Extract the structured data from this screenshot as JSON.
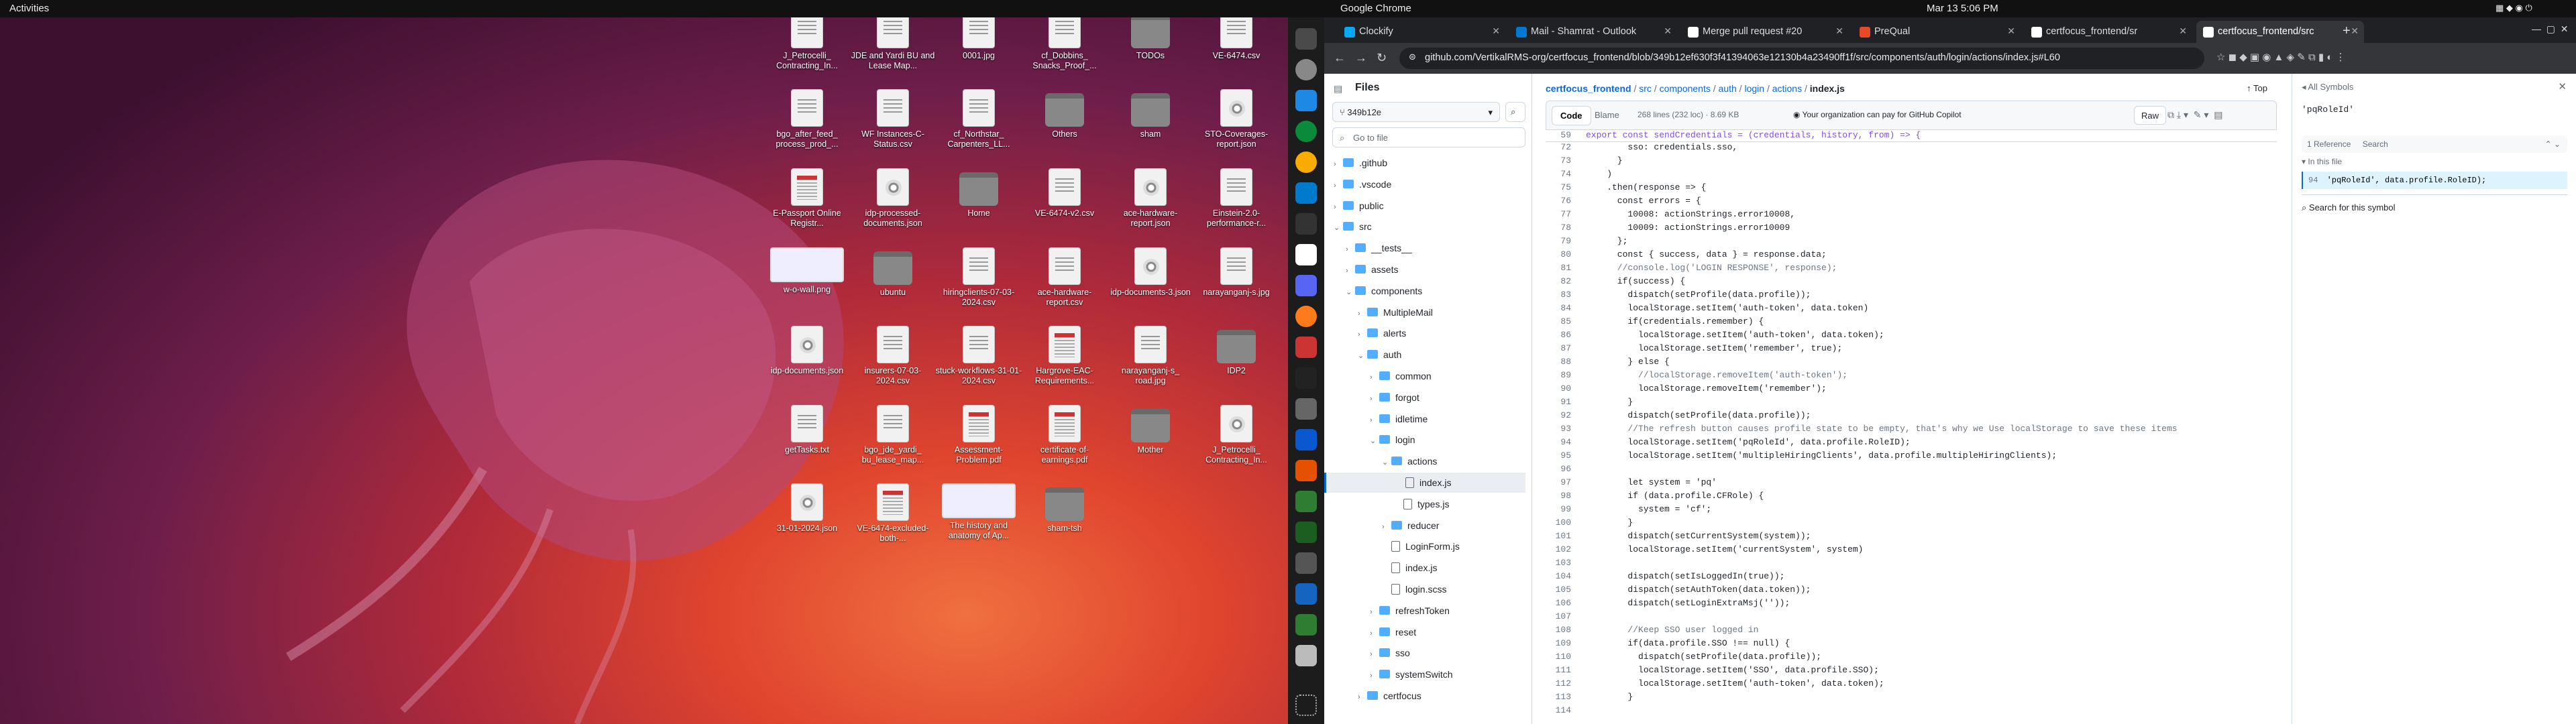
{
  "topbar": {
    "activities": "Activities",
    "app": "Google Chrome",
    "clock": "Mar 13  5:06 PM"
  },
  "desktop": {
    "icons": [
      {
        "label": "J_Petrocelli_ Contracting_In...",
        "type": "doc"
      },
      {
        "label": "JDE and Yardi BU and Lease Map...",
        "type": "doc"
      },
      {
        "label": "0001.jpg",
        "type": "doc"
      },
      {
        "label": "cf_Dobbins_ Snacks_Proof_...",
        "type": "doc"
      },
      {
        "label": "TODOs",
        "type": "folder"
      },
      {
        "label": "VE-6474.csv",
        "type": "doc"
      },
      {
        "label": "bgo_after_feed_ process_prod_...",
        "type": "doc"
      },
      {
        "label": "WF Instances-C-Status.csv",
        "type": "doc"
      },
      {
        "label": "cf_Northstar_ Carpenters_LL...",
        "type": "doc"
      },
      {
        "label": "Others",
        "type": "folder"
      },
      {
        "label": "sham",
        "type": "folder"
      },
      {
        "label": "STO-Coverages-report.json",
        "type": "disc"
      },
      {
        "label": "E-Passport Online Registr...",
        "type": "pdf"
      },
      {
        "label": "idp-processed-documents.json",
        "type": "disc"
      },
      {
        "label": "Home",
        "type": "folder"
      },
      {
        "label": "VE-6474-v2.csv",
        "type": "doc"
      },
      {
        "label": "ace-hardware-report.json",
        "type": "disc"
      },
      {
        "label": "Einstein-2.0-performance-r...",
        "type": "doc"
      },
      {
        "label": "w-o-wall.png",
        "type": "img"
      },
      {
        "label": "ubuntu",
        "type": "folder"
      },
      {
        "label": "hiringclients-07-03-2024.csv",
        "type": "doc"
      },
      {
        "label": "ace-hardware-report.csv",
        "type": "doc"
      },
      {
        "label": "idp-documents-3.json",
        "type": "disc"
      },
      {
        "label": "narayanganj-s.jpg",
        "type": "doc"
      },
      {
        "label": "idp-documents.json",
        "type": "disc"
      },
      {
        "label": "insurers-07-03-2024.csv",
        "type": "doc"
      },
      {
        "label": "stuck-workflows-31-01-2024.csv",
        "type": "doc"
      },
      {
        "label": "Hargrove-EAC-Requirements...",
        "type": "pdf"
      },
      {
        "label": "narayanganj-s_ road.jpg",
        "type": "doc"
      },
      {
        "label": "IDP2",
        "type": "folder"
      },
      {
        "label": "getTasks.txt",
        "type": "doc"
      },
      {
        "label": "bgo_jde_yardi_ bu_lease_map...",
        "type": "doc"
      },
      {
        "label": "Assessment-Problem.pdf",
        "type": "pdf"
      },
      {
        "label": "certificate-of-earnings.pdf",
        "type": "pdf"
      },
      {
        "label": "Mother",
        "type": "folder"
      },
      {
        "label": "J_Petrocelli_ Contracting_In...",
        "type": "disc"
      },
      {
        "label": "31-01-2024.json",
        "type": "disc"
      },
      {
        "label": "VE-6474-excluded-both-...",
        "type": "pdf"
      },
      {
        "label": "The history and anatomy of Ap...",
        "type": "img"
      },
      {
        "label": "sham-tsh",
        "type": "folder"
      }
    ]
  },
  "chrome": {
    "tabs": [
      {
        "label": "Clockify",
        "color": "#03a9f4"
      },
      {
        "label": "Mail - Shamrat - Outlook",
        "color": "#0078d4"
      },
      {
        "label": "Merge pull request #20",
        "color": "#ffffff"
      },
      {
        "label": "PreQual",
        "color": "#e84a27"
      },
      {
        "label": "certfocus_frontend/sr",
        "color": "#ffffff"
      },
      {
        "label": "certfocus_frontend/src",
        "color": "#ffffff"
      }
    ],
    "new_tab": "+",
    "url": "github.com/VertikalRMS-org/certfocus_frontend/blob/349b12ef630f3f41394063e12130b4a23490ff1f/src/components/auth/login/actions/index.js#L60"
  },
  "files": {
    "title": "Files",
    "branch": "349b12e",
    "goto_placeholder": "Go to file",
    "tree": [
      {
        "name": ".github",
        "kind": "dir",
        "depth": 0,
        "open": false
      },
      {
        "name": ".vscode",
        "kind": "dir",
        "depth": 0,
        "open": false
      },
      {
        "name": "public",
        "kind": "dir",
        "depth": 0,
        "open": false
      },
      {
        "name": "src",
        "kind": "dir",
        "depth": 0,
        "open": true
      },
      {
        "name": "__tests__",
        "kind": "dir",
        "depth": 1,
        "open": false
      },
      {
        "name": "assets",
        "kind": "dir",
        "depth": 1,
        "open": false
      },
      {
        "name": "components",
        "kind": "dir",
        "depth": 1,
        "open": true
      },
      {
        "name": "MultipleMail",
        "kind": "dir",
        "depth": 2,
        "open": false
      },
      {
        "name": "alerts",
        "kind": "dir",
        "depth": 2,
        "open": false
      },
      {
        "name": "auth",
        "kind": "dir",
        "depth": 2,
        "open": true
      },
      {
        "name": "common",
        "kind": "dir",
        "depth": 3,
        "open": false
      },
      {
        "name": "forgot",
        "kind": "dir",
        "depth": 3,
        "open": false
      },
      {
        "name": "idletime",
        "kind": "dir",
        "depth": 3,
        "open": false
      },
      {
        "name": "login",
        "kind": "dir",
        "depth": 3,
        "open": true
      },
      {
        "name": "actions",
        "kind": "dir",
        "depth": 4,
        "open": true
      },
      {
        "name": "index.js",
        "kind": "file",
        "depth": 5,
        "active": true
      },
      {
        "name": "types.js",
        "kind": "file",
        "depth": 5
      },
      {
        "name": "reducer",
        "kind": "dir",
        "depth": 4,
        "open": false
      },
      {
        "name": "LoginForm.js",
        "kind": "file",
        "depth": 4
      },
      {
        "name": "index.js",
        "kind": "file",
        "depth": 4
      },
      {
        "name": "login.scss",
        "kind": "file",
        "depth": 4
      },
      {
        "name": "refreshToken",
        "kind": "dir",
        "depth": 3,
        "open": false
      },
      {
        "name": "reset",
        "kind": "dir",
        "depth": 3,
        "open": false
      },
      {
        "name": "sso",
        "kind": "dir",
        "depth": 3,
        "open": false
      },
      {
        "name": "systemSwitch",
        "kind": "dir",
        "depth": 3,
        "open": false
      },
      {
        "name": "certfocus",
        "kind": "dir",
        "depth": 2,
        "open": false
      }
    ]
  },
  "code": {
    "breadcrumb": [
      "certfocus_frontend",
      "src",
      "components",
      "auth",
      "login",
      "actions",
      "index.js"
    ],
    "top_label": "Top",
    "tab_code": "Code",
    "tab_blame": "Blame",
    "meta": "268 lines (232 loc) · 8.69 KB",
    "copilot": "Your organization can pay for GitHub Copilot",
    "raw": "Raw",
    "sticky": "export const sendCredentials = (credentials, history, from) => {",
    "lines": [
      {
        "n": "72",
        "t": "        sso: credentials.sso,"
      },
      {
        "n": "73",
        "t": "      }"
      },
      {
        "n": "74",
        "t": "    )"
      },
      {
        "n": "75",
        "t": "    .then(response => {"
      },
      {
        "n": "76",
        "t": "      const errors = {"
      },
      {
        "n": "77",
        "t": "        10008: actionStrings.error10008,"
      },
      {
        "n": "78",
        "t": "        10009: actionStrings.error10009"
      },
      {
        "n": "79",
        "t": "      };"
      },
      {
        "n": "80",
        "t": "      const { success, data } = response.data;"
      },
      {
        "n": "81",
        "t": "      //console.log('LOGIN RESPONSE', response);"
      },
      {
        "n": "82",
        "t": "      if(success) {"
      },
      {
        "n": "83",
        "t": "        dispatch(setProfile(data.profile));"
      },
      {
        "n": "84",
        "t": "        localStorage.setItem('auth-token', data.token)"
      },
      {
        "n": "85",
        "t": "        if(credentials.remember) {"
      },
      {
        "n": "86",
        "t": "          localStorage.setItem('auth-token', data.token);"
      },
      {
        "n": "87",
        "t": "          localStorage.setItem('remember', true);"
      },
      {
        "n": "88",
        "t": "        } else {"
      },
      {
        "n": "89",
        "t": "          //localStorage.removeItem('auth-token');"
      },
      {
        "n": "90",
        "t": "          localStorage.removeItem('remember');"
      },
      {
        "n": "91",
        "t": "        }"
      },
      {
        "n": "92",
        "t": "        dispatch(setProfile(data.profile));"
      },
      {
        "n": "93",
        "t": "        //The refresh button causes profile state to be empty, that's why we Use localStorage to save these items"
      },
      {
        "n": "94",
        "t": "        localStorage.setItem('pqRoleId', data.profile.RoleID);"
      },
      {
        "n": "95",
        "t": "        localStorage.setItem('multipleHiringClients', data.profile.multipleHiringClients);"
      },
      {
        "n": "96",
        "t": ""
      },
      {
        "n": "97",
        "t": "        let system = 'pq'"
      },
      {
        "n": "98",
        "t": "        if (data.profile.CFRole) {"
      },
      {
        "n": "99",
        "t": "          system = 'cf';"
      },
      {
        "n": "100",
        "t": "        }"
      },
      {
        "n": "101",
        "t": "        dispatch(setCurrentSystem(system));"
      },
      {
        "n": "102",
        "t": "        localStorage.setItem('currentSystem', system)"
      },
      {
        "n": "103",
        "t": ""
      },
      {
        "n": "104",
        "t": "        dispatch(setIsLoggedIn(true));"
      },
      {
        "n": "105",
        "t": "        dispatch(setAuthToken(data.token));"
      },
      {
        "n": "106",
        "t": "        dispatch(setLoginExtraMsj(''));"
      },
      {
        "n": "107",
        "t": ""
      },
      {
        "n": "108",
        "t": "        //Keep SSO user logged in"
      },
      {
        "n": "109",
        "t": "        if(data.profile.SSO !== null) {"
      },
      {
        "n": "110",
        "t": "          dispatch(setProfile(data.profile));"
      },
      {
        "n": "111",
        "t": "          localStorage.setItem('SSO', data.profile.SSO);"
      },
      {
        "n": "112",
        "t": "          localStorage.setItem('auth-token', data.token);"
      },
      {
        "n": "113",
        "t": "        }"
      },
      {
        "n": "114",
        "t": ""
      }
    ]
  },
  "symbols": {
    "title": "All Symbols",
    "query": "'pqRoleId'",
    "refs": "1 Reference",
    "search": "Search",
    "in_file": "In this file",
    "ref_line": "'pqRoleId', data.profile.RoleID);",
    "ref_num": "94",
    "search_symbol": "Search for this symbol"
  }
}
